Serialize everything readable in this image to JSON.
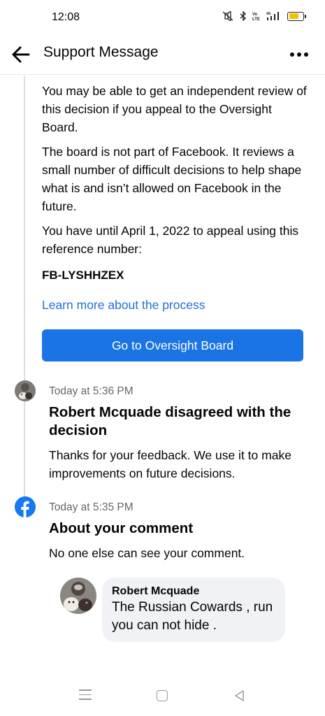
{
  "status_bar": {
    "time": "12:08",
    "icons": [
      "mute-icon",
      "bluetooth-icon",
      "volte-icon",
      "signal-4g-icon",
      "battery-icon"
    ]
  },
  "header": {
    "title": "Support Message",
    "back_icon": "arrow-left-icon",
    "more_icon": "more-horizontal-icon"
  },
  "message": {
    "paragraphs": [
      "You may be able to get an independent review of this decision if you appeal to the Oversight Board.",
      "The board is not part of Facebook. It reviews a small number of difficult decisions to help shape what is and isn’t allowed on Facebook in the future.",
      "You have until April 1, 2022 to appeal using this reference number:"
    ],
    "reference_number": "FB-LYSHHZEX",
    "learn_more_link": "Learn more about the process",
    "oversight_button": "Go to Oversight Board",
    "button_color": "#1b74e4",
    "link_color": "#216fdb"
  },
  "timeline": [
    {
      "time": "Today at 5:36 PM",
      "title": "Robert Mcquade disagreed with the decision",
      "body": "Thanks for your feedback. We use it to make improvements on future decisions."
    },
    {
      "time": "Today at 5:35 PM",
      "title": "About your comment",
      "body": "No one else can see your comment."
    }
  ],
  "comment": {
    "author": "Robert Mcquade",
    "text": "The Russian Cowards , run you can not hide ."
  },
  "nav_bar": {
    "icons": [
      "menu-icon",
      "home-square-icon",
      "back-triangle-icon"
    ]
  }
}
